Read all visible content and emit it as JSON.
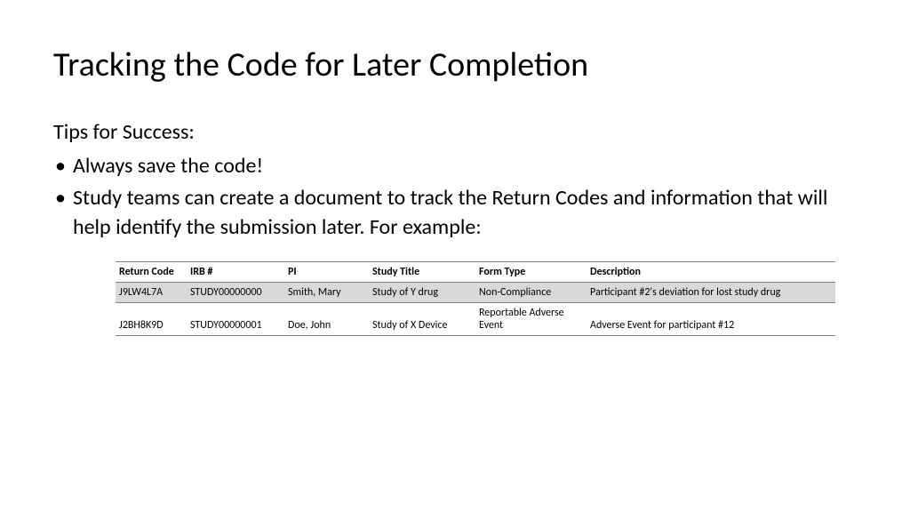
{
  "title": "Tracking the Code for Later Completion",
  "subtitle": "Tips for Success:",
  "bullets": [
    "Always save the code!",
    "Study teams can create a document to track the Return Codes and information that will help identify the submission later.  For example:"
  ],
  "table": {
    "headers": {
      "return_code": "Return Code",
      "irb": "IRB #",
      "pi": "PI",
      "study_title": "Study Title",
      "form_type": "Form Type",
      "description": "Description"
    },
    "rows": [
      {
        "return_code": "J9LW4L7A",
        "irb": "STUDY00000000",
        "pi": "Smith, Mary",
        "study_title": "Study of Y drug",
        "form_type": "Non-Compliance",
        "description": "Participant #2's deviation for lost study drug"
      },
      {
        "return_code": "J2BH8K9D",
        "irb": "STUDY00000001",
        "pi": "Doe, John",
        "study_title": "Study of X Device",
        "form_type": "Reportable Adverse Event",
        "description": "Adverse Event for participant #12"
      }
    ]
  }
}
